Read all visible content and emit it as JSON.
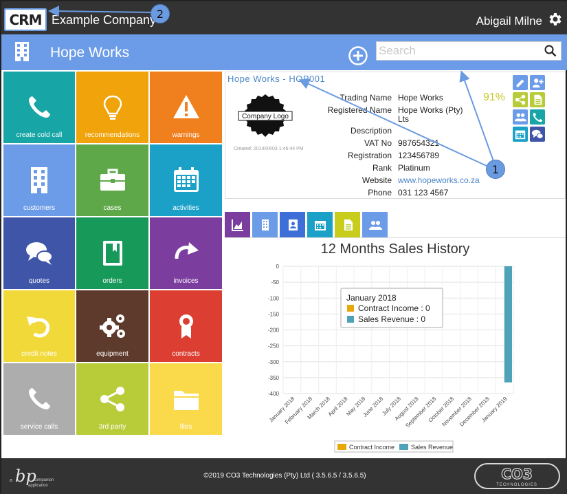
{
  "header": {
    "logo_text": "CRM",
    "company": "Example Company",
    "user": "Abigail Milne"
  },
  "bluebar": {
    "title": "Hope Works",
    "search_placeholder": "Search"
  },
  "tiles": [
    {
      "label": "create cold call",
      "color": "#17a5a5",
      "icon": "phone-icon"
    },
    {
      "label": "recommendations",
      "color": "#f0a30a",
      "icon": "lightbulb-icon"
    },
    {
      "label": "warnings",
      "color": "#f07f1e",
      "icon": "warning-icon"
    },
    {
      "label": "customers",
      "color": "#6c9ce8",
      "icon": "building-icon"
    },
    {
      "label": "cases",
      "color": "#5fa84a",
      "icon": "briefcase-icon"
    },
    {
      "label": "activities",
      "color": "#1ba1c8",
      "icon": "calendar-icon"
    },
    {
      "label": "quotes",
      "color": "#3e55a8",
      "icon": "chat-icon"
    },
    {
      "label": "orders",
      "color": "#17995a",
      "icon": "book-icon"
    },
    {
      "label": "invoices",
      "color": "#7b3e9e",
      "icon": "redo-icon"
    },
    {
      "label": "credit notes",
      "color": "#f2d93a",
      "icon": "undo-icon"
    },
    {
      "label": "equipment",
      "color": "#5e3a2c",
      "icon": "gears-icon"
    },
    {
      "label": "contracts",
      "color": "#dc3f32",
      "icon": "award-icon"
    },
    {
      "label": "service calls",
      "color": "#adadad",
      "icon": "phone-icon"
    },
    {
      "label": "3rd party",
      "color": "#b8cc3a",
      "icon": "share-icon"
    },
    {
      "label": "files",
      "color": "#fad94a",
      "icon": "folder-icon"
    }
  ],
  "record": {
    "title": "Hope Works - HOP001",
    "logo_text": "Company Logo",
    "created": "Created: 2014/04/03 1:46:44 PM",
    "percent": "91%",
    "fields": [
      {
        "label": "Trading Name",
        "value": "Hope Works"
      },
      {
        "label": "Registered Name",
        "value": "Hope Works (Pty)",
        "value2": "Lts"
      },
      {
        "label": "Description",
        "value": ""
      },
      {
        "label": "VAT No",
        "value": "987654321"
      },
      {
        "label": "Registration",
        "value": "123456789"
      },
      {
        "label": "Rank",
        "value": "Platinum"
      },
      {
        "label": "Website",
        "value": "www.hopeworks.co.za"
      },
      {
        "label": "Phone",
        "value": "031 123 4567"
      }
    ],
    "link_color": "#4a86c8"
  },
  "actions": [
    {
      "icon": "edit-icon",
      "color": "#6c9ce8"
    },
    {
      "icon": "add-contact-icon",
      "color": "#6c9ce8"
    },
    {
      "icon": "share-icon",
      "color": "#b8cc3a"
    },
    {
      "icon": "document-icon",
      "color": "#b8cc3a"
    },
    {
      "icon": "contacts-icon",
      "color": "#6c9ce8"
    },
    {
      "icon": "phone-icon",
      "color": "#17a5a5"
    },
    {
      "icon": "calendar-icon",
      "color": "#1ba1c8"
    },
    {
      "icon": "chat-icon",
      "color": "#3e55a8"
    }
  ],
  "tabs": [
    {
      "icon": "area-chart-icon",
      "color": "#7b3e9e"
    },
    {
      "icon": "building-icon",
      "color": "#6c9ce8"
    },
    {
      "icon": "contact-card-icon",
      "color": "#3e6fd8"
    },
    {
      "icon": "calendar-icon",
      "color": "#1ba1c8"
    },
    {
      "icon": "document-icon",
      "color": "#c8cc1a"
    },
    {
      "icon": "contacts-icon",
      "color": "#6c9ce8"
    }
  ],
  "callouts": [
    "1",
    "2"
  ],
  "chart_data": {
    "type": "bar",
    "title": "12 Months Sales History",
    "categories": [
      "January 2018",
      "February 2018",
      "March 2018",
      "April 2018",
      "May 2018",
      "June 2018",
      "July 2018",
      "August 2018",
      "September 2018",
      "October 2018",
      "November 2018",
      "December 2018",
      "January 2019"
    ],
    "series": [
      {
        "name": "Contract Income",
        "color": "#e8a80a",
        "values": [
          0,
          0,
          0,
          0,
          0,
          0,
          0,
          0,
          0,
          0,
          0,
          0,
          0
        ]
      },
      {
        "name": "Sales Revenue",
        "color": "#4fa3b8",
        "values": [
          0,
          0,
          0,
          0,
          0,
          0,
          0,
          0,
          0,
          0,
          0,
          0,
          -365
        ]
      }
    ],
    "ylim": [
      -400,
      0
    ],
    "yticks": [
      0,
      -50,
      -100,
      -150,
      -200,
      -250,
      -300,
      -350,
      -400
    ],
    "grid": true,
    "legend": "bottom",
    "tooltip": {
      "title": "January 2018",
      "lines": [
        "Contract Income : 0",
        "Sales Revenue : 0"
      ]
    }
  },
  "footer": {
    "copyright": "©2019 CO3 Technologies (Pty) Ltd ( 3.5.6.5 / 3.5.6.5)",
    "bp_small_left": "a",
    "bp_small_right": "companion",
    "bp_small_bottom": "application",
    "co3_text": "CO3",
    "co3_sub": "TECHNOLOGIES"
  }
}
